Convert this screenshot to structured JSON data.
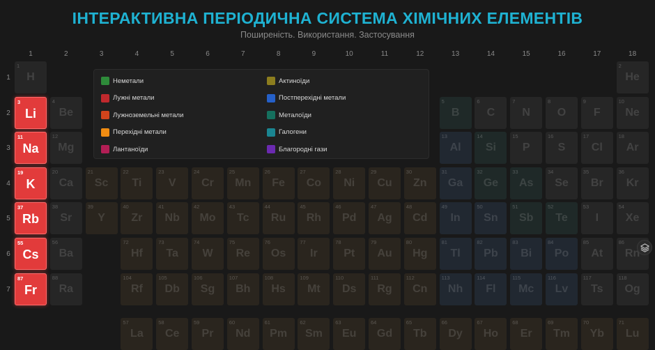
{
  "header": {
    "title": "ІНТЕРАКТИВНА ПЕРІОДИЧНА СИСТЕМА ХІМІЧНИХ ЕЛЕМЕНТІВ",
    "subtitle": "Поширеність. Використання. Застосування"
  },
  "groups": [
    "1",
    "2",
    "3",
    "4",
    "5",
    "6",
    "7",
    "8",
    "9",
    "10",
    "11",
    "12",
    "13",
    "14",
    "15",
    "16",
    "17",
    "18"
  ],
  "periods": [
    "1",
    "2",
    "3",
    "4",
    "5",
    "6",
    "7"
  ],
  "legend": [
    {
      "label": "Неметали",
      "color": "#2e8b3a"
    },
    {
      "label": "Актиноїди",
      "color": "#8c7d1e"
    },
    {
      "label": "Лужні метали",
      "color": "#c0292d"
    },
    {
      "label": "Постперехідні метали",
      "color": "#2560c9"
    },
    {
      "label": "Лужноземельні метали",
      "color": "#d2441c"
    },
    {
      "label": "Металоїди",
      "color": "#15705e"
    },
    {
      "label": "Перехідні метали",
      "color": "#f08c12"
    },
    {
      "label": "Галогени",
      "color": "#1a8591"
    },
    {
      "label": "Лантаноїди",
      "color": "#b21e55"
    },
    {
      "label": "Благородні гази",
      "color": "#6b2ab0"
    }
  ],
  "highlighted_category": "Лужні метали",
  "elements": [
    {
      "n": "1",
      "s": "H",
      "p": 1,
      "g": 1,
      "c": "gray"
    },
    {
      "n": "2",
      "s": "He",
      "p": 1,
      "g": 18,
      "c": "gray"
    },
    {
      "n": "3",
      "s": "Li",
      "p": 2,
      "g": 1,
      "c": "hl"
    },
    {
      "n": "4",
      "s": "Be",
      "p": 2,
      "g": 2,
      "c": "gray"
    },
    {
      "n": "5",
      "s": "B",
      "p": 2,
      "g": 13,
      "c": "teal"
    },
    {
      "n": "6",
      "s": "C",
      "p": 2,
      "g": 14,
      "c": "gray"
    },
    {
      "n": "7",
      "s": "N",
      "p": 2,
      "g": 15,
      "c": "gray"
    },
    {
      "n": "8",
      "s": "O",
      "p": 2,
      "g": 16,
      "c": "gray"
    },
    {
      "n": "9",
      "s": "F",
      "p": 2,
      "g": 17,
      "c": "gray"
    },
    {
      "n": "10",
      "s": "Ne",
      "p": 2,
      "g": 18,
      "c": "gray"
    },
    {
      "n": "11",
      "s": "Na",
      "p": 3,
      "g": 1,
      "c": "hl"
    },
    {
      "n": "12",
      "s": "Mg",
      "p": 3,
      "g": 2,
      "c": "gray"
    },
    {
      "n": "13",
      "s": "Al",
      "p": 3,
      "g": 13,
      "c": "blue"
    },
    {
      "n": "14",
      "s": "Si",
      "p": 3,
      "g": 14,
      "c": "teal"
    },
    {
      "n": "15",
      "s": "P",
      "p": 3,
      "g": 15,
      "c": "gray"
    },
    {
      "n": "16",
      "s": "S",
      "p": 3,
      "g": 16,
      "c": "gray"
    },
    {
      "n": "17",
      "s": "Cl",
      "p": 3,
      "g": 17,
      "c": "gray"
    },
    {
      "n": "18",
      "s": "Ar",
      "p": 3,
      "g": 18,
      "c": "gray"
    },
    {
      "n": "19",
      "s": "K",
      "p": 4,
      "g": 1,
      "c": "hl"
    },
    {
      "n": "20",
      "s": "Ca",
      "p": 4,
      "g": 2,
      "c": "gray"
    },
    {
      "n": "21",
      "s": "Sc",
      "p": 4,
      "g": 3,
      "c": "brown"
    },
    {
      "n": "22",
      "s": "Ti",
      "p": 4,
      "g": 4,
      "c": "brown"
    },
    {
      "n": "23",
      "s": "V",
      "p": 4,
      "g": 5,
      "c": "brown"
    },
    {
      "n": "24",
      "s": "Cr",
      "p": 4,
      "g": 6,
      "c": "brown"
    },
    {
      "n": "25",
      "s": "Mn",
      "p": 4,
      "g": 7,
      "c": "brown"
    },
    {
      "n": "26",
      "s": "Fe",
      "p": 4,
      "g": 8,
      "c": "brown"
    },
    {
      "n": "27",
      "s": "Co",
      "p": 4,
      "g": 9,
      "c": "brown"
    },
    {
      "n": "28",
      "s": "Ni",
      "p": 4,
      "g": 10,
      "c": "brown"
    },
    {
      "n": "29",
      "s": "Cu",
      "p": 4,
      "g": 11,
      "c": "brown"
    },
    {
      "n": "30",
      "s": "Zn",
      "p": 4,
      "g": 12,
      "c": "brown"
    },
    {
      "n": "31",
      "s": "Ga",
      "p": 4,
      "g": 13,
      "c": "blue"
    },
    {
      "n": "32",
      "s": "Ge",
      "p": 4,
      "g": 14,
      "c": "teal"
    },
    {
      "n": "33",
      "s": "As",
      "p": 4,
      "g": 15,
      "c": "teal"
    },
    {
      "n": "34",
      "s": "Se",
      "p": 4,
      "g": 16,
      "c": "gray"
    },
    {
      "n": "35",
      "s": "Br",
      "p": 4,
      "g": 17,
      "c": "gray"
    },
    {
      "n": "36",
      "s": "Kr",
      "p": 4,
      "g": 18,
      "c": "gray"
    },
    {
      "n": "37",
      "s": "Rb",
      "p": 5,
      "g": 1,
      "c": "hl"
    },
    {
      "n": "38",
      "s": "Sr",
      "p": 5,
      "g": 2,
      "c": "gray"
    },
    {
      "n": "39",
      "s": "Y",
      "p": 5,
      "g": 3,
      "c": "brown"
    },
    {
      "n": "40",
      "s": "Zr",
      "p": 5,
      "g": 4,
      "c": "brown"
    },
    {
      "n": "41",
      "s": "Nb",
      "p": 5,
      "g": 5,
      "c": "brown"
    },
    {
      "n": "42",
      "s": "Mo",
      "p": 5,
      "g": 6,
      "c": "brown"
    },
    {
      "n": "43",
      "s": "Tc",
      "p": 5,
      "g": 7,
      "c": "brown"
    },
    {
      "n": "44",
      "s": "Ru",
      "p": 5,
      "g": 8,
      "c": "brown"
    },
    {
      "n": "45",
      "s": "Rh",
      "p": 5,
      "g": 9,
      "c": "brown"
    },
    {
      "n": "46",
      "s": "Pd",
      "p": 5,
      "g": 10,
      "c": "brown"
    },
    {
      "n": "47",
      "s": "Ag",
      "p": 5,
      "g": 11,
      "c": "brown"
    },
    {
      "n": "48",
      "s": "Cd",
      "p": 5,
      "g": 12,
      "c": "brown"
    },
    {
      "n": "49",
      "s": "In",
      "p": 5,
      "g": 13,
      "c": "blue"
    },
    {
      "n": "50",
      "s": "Sn",
      "p": 5,
      "g": 14,
      "c": "blue"
    },
    {
      "n": "51",
      "s": "Sb",
      "p": 5,
      "g": 15,
      "c": "teal"
    },
    {
      "n": "52",
      "s": "Te",
      "p": 5,
      "g": 16,
      "c": "teal"
    },
    {
      "n": "53",
      "s": "I",
      "p": 5,
      "g": 17,
      "c": "gray"
    },
    {
      "n": "54",
      "s": "Xe",
      "p": 5,
      "g": 18,
      "c": "gray"
    },
    {
      "n": "55",
      "s": "Cs",
      "p": 6,
      "g": 1,
      "c": "hl"
    },
    {
      "n": "56",
      "s": "Ba",
      "p": 6,
      "g": 2,
      "c": "gray"
    },
    {
      "n": "72",
      "s": "Hf",
      "p": 6,
      "g": 4,
      "c": "brown"
    },
    {
      "n": "73",
      "s": "Ta",
      "p": 6,
      "g": 5,
      "c": "brown"
    },
    {
      "n": "74",
      "s": "W",
      "p": 6,
      "g": 6,
      "c": "brown"
    },
    {
      "n": "75",
      "s": "Re",
      "p": 6,
      "g": 7,
      "c": "brown"
    },
    {
      "n": "76",
      "s": "Os",
      "p": 6,
      "g": 8,
      "c": "brown"
    },
    {
      "n": "77",
      "s": "Ir",
      "p": 6,
      "g": 9,
      "c": "brown"
    },
    {
      "n": "78",
      "s": "Pt",
      "p": 6,
      "g": 10,
      "c": "brown"
    },
    {
      "n": "79",
      "s": "Au",
      "p": 6,
      "g": 11,
      "c": "brown"
    },
    {
      "n": "80",
      "s": "Hg",
      "p": 6,
      "g": 12,
      "c": "brown"
    },
    {
      "n": "81",
      "s": "Tl",
      "p": 6,
      "g": 13,
      "c": "blue"
    },
    {
      "n": "82",
      "s": "Pb",
      "p": 6,
      "g": 14,
      "c": "blue"
    },
    {
      "n": "83",
      "s": "Bi",
      "p": 6,
      "g": 15,
      "c": "blue"
    },
    {
      "n": "84",
      "s": "Po",
      "p": 6,
      "g": 16,
      "c": "blue"
    },
    {
      "n": "85",
      "s": "At",
      "p": 6,
      "g": 17,
      "c": "gray"
    },
    {
      "n": "86",
      "s": "Rn",
      "p": 6,
      "g": 18,
      "c": "gray"
    },
    {
      "n": "87",
      "s": "Fr",
      "p": 7,
      "g": 1,
      "c": "hl"
    },
    {
      "n": "88",
      "s": "Ra",
      "p": 7,
      "g": 2,
      "c": "gray"
    },
    {
      "n": "104",
      "s": "Rf",
      "p": 7,
      "g": 4,
      "c": "brown"
    },
    {
      "n": "105",
      "s": "Db",
      "p": 7,
      "g": 5,
      "c": "brown"
    },
    {
      "n": "106",
      "s": "Sg",
      "p": 7,
      "g": 6,
      "c": "brown"
    },
    {
      "n": "107",
      "s": "Bh",
      "p": 7,
      "g": 7,
      "c": "brown"
    },
    {
      "n": "108",
      "s": "Hs",
      "p": 7,
      "g": 8,
      "c": "brown"
    },
    {
      "n": "109",
      "s": "Mt",
      "p": 7,
      "g": 9,
      "c": "brown"
    },
    {
      "n": "110",
      "s": "Ds",
      "p": 7,
      "g": 10,
      "c": "brown"
    },
    {
      "n": "111",
      "s": "Rg",
      "p": 7,
      "g": 11,
      "c": "brown"
    },
    {
      "n": "112",
      "s": "Cn",
      "p": 7,
      "g": 12,
      "c": "brown"
    },
    {
      "n": "113",
      "s": "Nh",
      "p": 7,
      "g": 13,
      "c": "blue"
    },
    {
      "n": "114",
      "s": "Fl",
      "p": 7,
      "g": 14,
      "c": "blue"
    },
    {
      "n": "115",
      "s": "Mc",
      "p": 7,
      "g": 15,
      "c": "blue"
    },
    {
      "n": "116",
      "s": "Lv",
      "p": 7,
      "g": 16,
      "c": "blue"
    },
    {
      "n": "117",
      "s": "Ts",
      "p": 7,
      "g": 17,
      "c": "gray"
    },
    {
      "n": "118",
      "s": "Og",
      "p": 7,
      "g": 18,
      "c": "gray"
    },
    {
      "n": "57",
      "s": "La",
      "p": 8,
      "g": 4,
      "c": "brown"
    },
    {
      "n": "58",
      "s": "Ce",
      "p": 8,
      "g": 5,
      "c": "brown"
    },
    {
      "n": "59",
      "s": "Pr",
      "p": 8,
      "g": 6,
      "c": "brown"
    },
    {
      "n": "60",
      "s": "Nd",
      "p": 8,
      "g": 7,
      "c": "brown"
    },
    {
      "n": "61",
      "s": "Pm",
      "p": 8,
      "g": 8,
      "c": "brown"
    },
    {
      "n": "62",
      "s": "Sm",
      "p": 8,
      "g": 9,
      "c": "brown"
    },
    {
      "n": "63",
      "s": "Eu",
      "p": 8,
      "g": 10,
      "c": "brown"
    },
    {
      "n": "64",
      "s": "Gd",
      "p": 8,
      "g": 11,
      "c": "brown"
    },
    {
      "n": "65",
      "s": "Tb",
      "p": 8,
      "g": 12,
      "c": "brown"
    },
    {
      "n": "66",
      "s": "Dy",
      "p": 8,
      "g": 13,
      "c": "brown"
    },
    {
      "n": "67",
      "s": "Ho",
      "p": 8,
      "g": 14,
      "c": "brown"
    },
    {
      "n": "68",
      "s": "Er",
      "p": 8,
      "g": 15,
      "c": "brown"
    },
    {
      "n": "69",
      "s": "Tm",
      "p": 8,
      "g": 16,
      "c": "brown"
    },
    {
      "n": "70",
      "s": "Yb",
      "p": 8,
      "g": 17,
      "c": "brown"
    },
    {
      "n": "71",
      "s": "Lu",
      "p": 8,
      "g": 18,
      "c": "brown"
    }
  ],
  "dim_colors": {
    "gray": "#262626",
    "brown": "#2a251e",
    "blue": "#212831",
    "teal": "#1f2928"
  },
  "floating_button": {
    "icon": "layers-icon"
  }
}
